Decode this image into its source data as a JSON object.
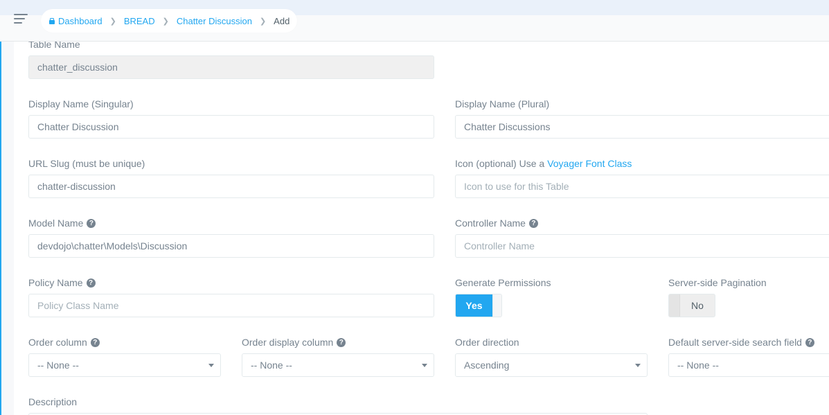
{
  "breadcrumb": {
    "items": [
      {
        "label": "Dashboard"
      },
      {
        "label": "BREAD"
      },
      {
        "label": "Chatter Discussion"
      }
    ],
    "current": "Add"
  },
  "form": {
    "table_name": {
      "label": "Table Name",
      "value": "chatter_discussion"
    },
    "display_singular": {
      "label": "Display Name (Singular)",
      "value": "Chatter Discussion"
    },
    "display_plural": {
      "label": "Display Name (Plural)",
      "value": "Chatter Discussions"
    },
    "url_slug": {
      "label": "URL Slug (must be unique)",
      "value": "chatter-discussion"
    },
    "icon": {
      "label": "Icon (optional) Use a",
      "link": "Voyager Font Class",
      "placeholder": "Icon to use for this Table"
    },
    "model_name": {
      "label": "Model Name",
      "value": "devdojo\\chatter\\Models\\Discussion"
    },
    "controller_name": {
      "label": "Controller Name",
      "placeholder": "Controller Name"
    },
    "policy_name": {
      "label": "Policy Name",
      "placeholder": "Policy Class Name"
    },
    "generate_permissions": {
      "label": "Generate Permissions",
      "state": "Yes"
    },
    "server_pagination": {
      "label": "Server-side Pagination",
      "state": "No"
    },
    "order_column": {
      "label": "Order column",
      "value": "-- None --"
    },
    "order_display_column": {
      "label": "Order display column",
      "value": "-- None --"
    },
    "order_direction": {
      "label": "Order direction",
      "value": "Ascending"
    },
    "default_search": {
      "label": "Default server-side search field",
      "value": "-- None --"
    },
    "description": {
      "label": "Description"
    }
  },
  "colors": {
    "accent": "#22a7f0",
    "text": "#76838f"
  },
  "icons": {
    "menu": "hamburger-menu-icon",
    "home": "home-icon",
    "help": "question-circle-icon",
    "separator": "chevron-right-icon"
  }
}
